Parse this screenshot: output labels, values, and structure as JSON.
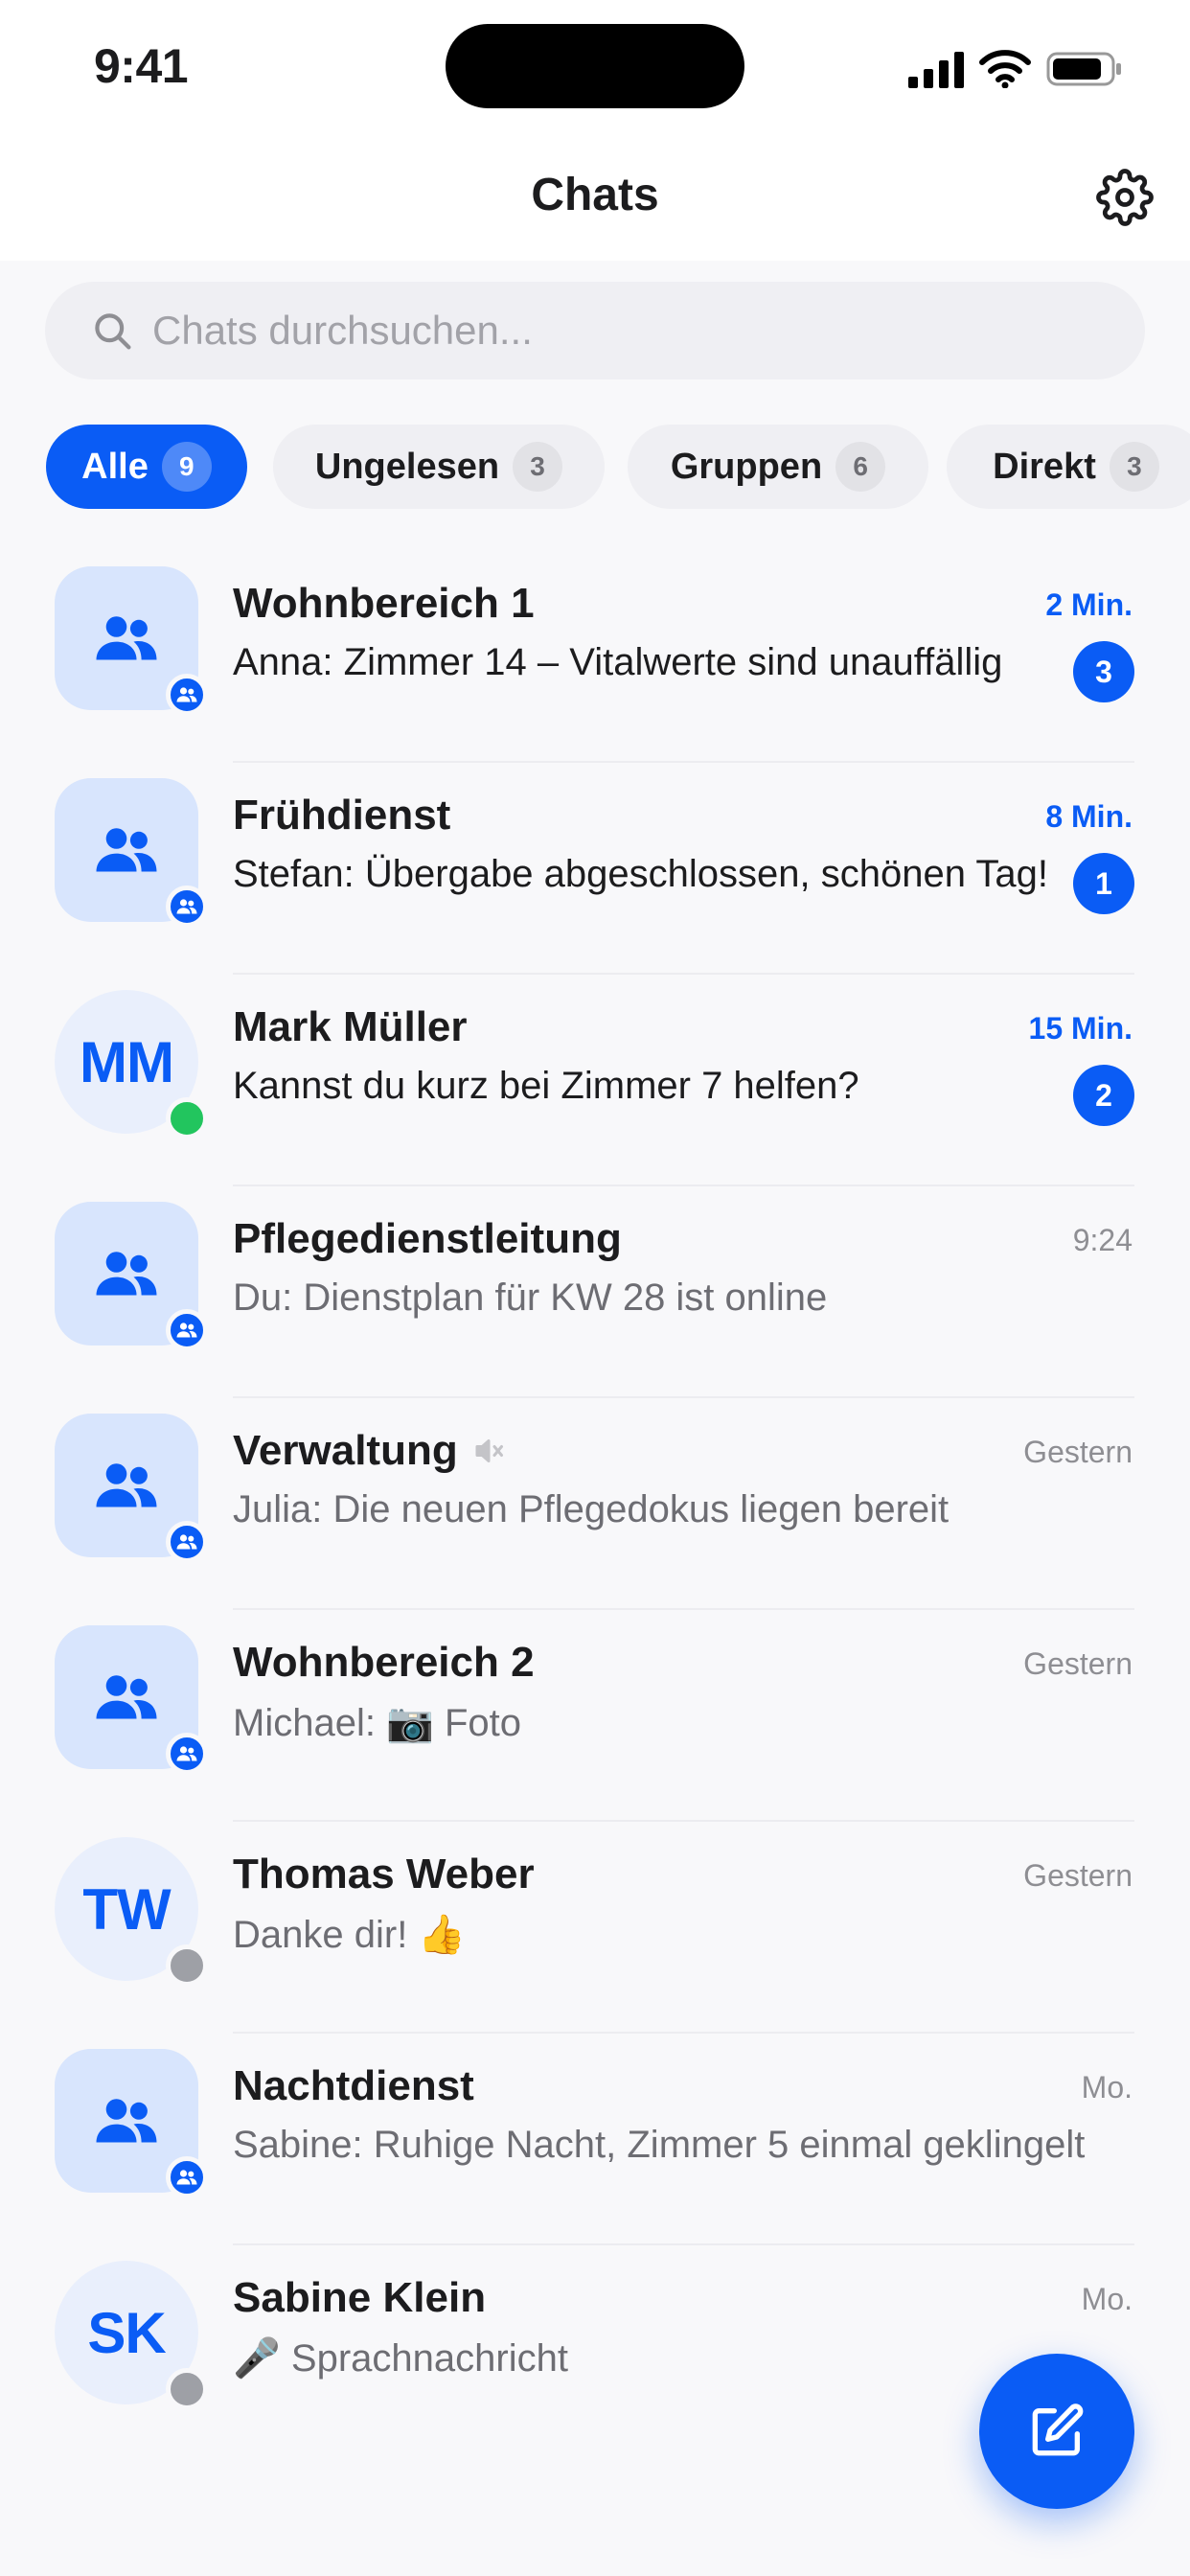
{
  "status_bar": {
    "time": "9:41"
  },
  "header": {
    "title": "Chats"
  },
  "search": {
    "placeholder": "Chats durchsuchen..."
  },
  "filters": [
    {
      "label": "Alle",
      "count": "9",
      "active": true
    },
    {
      "label": "Ungelesen",
      "count": "3",
      "active": false
    },
    {
      "label": "Gruppen",
      "count": "6",
      "active": false
    },
    {
      "label": "Direkt",
      "count": "3",
      "active": false
    }
  ],
  "chats": [
    {
      "name": "Wohnbereich 1",
      "type": "group",
      "time": "2 Min.",
      "preview": "Anna: Zimmer 14 – Vitalwerte sind unauffällig",
      "unread": "3"
    },
    {
      "name": "Frühdienst",
      "type": "group",
      "time": "8 Min.",
      "preview": "Stefan: Übergabe abgeschlossen, schönen Tag!",
      "unread": "1"
    },
    {
      "name": "Mark Müller",
      "type": "person",
      "initials": "MM",
      "presence": "online",
      "time": "15 Min.",
      "preview": "Kannst du kurz bei Zimmer 7 helfen?",
      "unread": "2"
    },
    {
      "name": "Pflegedienstleitung",
      "type": "group",
      "time": "9:24",
      "preview": "Du: Dienstplan für KW 28 ist online"
    },
    {
      "name": "Verwaltung",
      "type": "group",
      "muted": true,
      "time": "Gestern",
      "preview": "Julia: Die neuen Pflegedokus liegen bereit"
    },
    {
      "name": "Wohnbereich 2",
      "type": "group",
      "time": "Gestern",
      "preview": "Michael: 📷 Foto"
    },
    {
      "name": "Thomas Weber",
      "type": "person",
      "initials": "TW",
      "presence": "offline",
      "time": "Gestern",
      "preview": "Danke dir! 👍"
    },
    {
      "name": "Nachtdienst",
      "type": "group",
      "time": "Mo.",
      "preview": "Sabine: Ruhige Nacht, Zimmer 5 einmal geklingelt"
    },
    {
      "name": "Sabine Klein",
      "type": "person",
      "initials": "SK",
      "presence": "offline",
      "time": "Mo.",
      "preview": "🎤 Sprachnachricht"
    }
  ],
  "icons": {
    "settings": "gear-icon",
    "search": "search-icon",
    "group": "group-icon",
    "compose": "compose-icon",
    "muted": "muted-icon"
  },
  "colors": {
    "accent": "#0a5cf5",
    "online": "#22c55e",
    "offline": "#9ea0a6"
  }
}
